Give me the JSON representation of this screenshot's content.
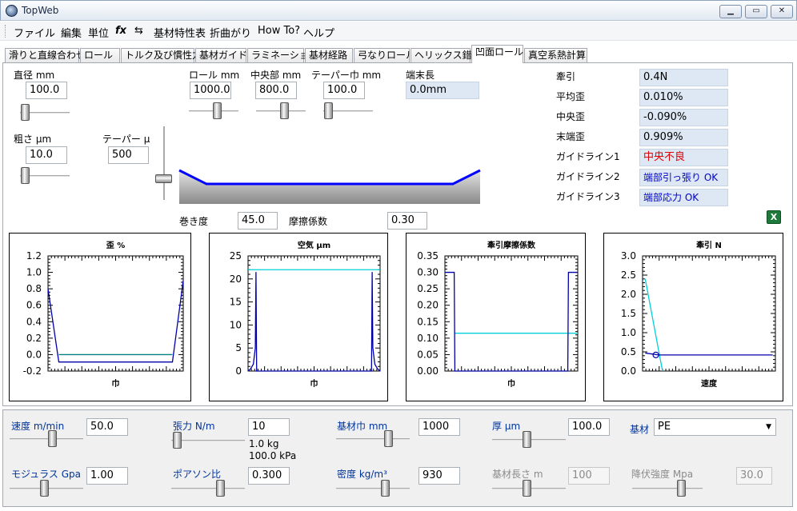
{
  "window": {
    "title": "TopWeb"
  },
  "menu": [
    "ファイル",
    "編集",
    "単位",
    "fx",
    "⇆",
    "基材特性表",
    "折曲がり",
    "How To?",
    "ヘルプ"
  ],
  "tabs": [
    "滑りと直線合わせ",
    "ロール",
    "トルク及び慣性力",
    "基材ガイド",
    "ラミネーション",
    "基材経路",
    "弓なりロール",
    "ヘリックス錯覚",
    "凹面ロール",
    "真空系熱計算"
  ],
  "active_tab": 8,
  "params": {
    "diameter": {
      "label": "直径 mm",
      "value": "100.0"
    },
    "roughness": {
      "label": "粗さ μm",
      "value": "10.0"
    },
    "taper": {
      "label": "テーパー μm",
      "value": "500"
    },
    "roll": {
      "label": "ロール mm",
      "value": "1000.0"
    },
    "center": {
      "label": "中央部 mm",
      "value": "800.0"
    },
    "taper_width": {
      "label": "テーパー巾 mm",
      "value": "100.0"
    },
    "end_length": {
      "label": "端末長",
      "value": "0.0mm"
    },
    "wrap": {
      "label": "巻き度",
      "value": "45.0"
    },
    "friction": {
      "label": "摩擦係数",
      "value": "0.30"
    }
  },
  "results": [
    {
      "label": "牽引",
      "value": "0.4N",
      "status": "normal"
    },
    {
      "label": "平均歪",
      "value": "0.010%",
      "status": "normal"
    },
    {
      "label": "中央歪",
      "value": "-0.090%",
      "status": "normal"
    },
    {
      "label": "末端歪",
      "value": "0.909%",
      "status": "normal"
    },
    {
      "label": "ガイドライン1",
      "value": "中央不良",
      "status": "bad"
    },
    {
      "label": "ガイドライン2",
      "value": "端部引っ張り OK",
      "status": "ok"
    },
    {
      "label": "ガイドライン3",
      "value": "端部応力 OK",
      "status": "ok"
    }
  ],
  "colors": {
    "navy": "#0000aa",
    "cyan": "#00d0d8",
    "green": "#008000",
    "profile": "#0000ff"
  },
  "chart_data": [
    {
      "type": "line",
      "title": "歪 %",
      "xlabel": "巾",
      "ylim": [
        -0.2,
        1.2
      ],
      "yticks": [
        -0.2,
        0.0,
        0.2,
        0.4,
        0.6,
        0.8,
        1.0,
        1.2
      ],
      "series": [
        {
          "color": "#0000aa",
          "x": [
            0,
            0.08,
            0.92,
            1
          ],
          "y": [
            0.8,
            -0.09,
            -0.09,
            0.9
          ]
        },
        {
          "color": "#008080",
          "x": [
            0.08,
            0.92
          ],
          "y": [
            0.0,
            0.0
          ]
        }
      ]
    },
    {
      "type": "line",
      "title": "空気 μm",
      "xlabel": "巾",
      "ylim": [
        0,
        25
      ],
      "yticks": [
        0,
        5,
        10,
        15,
        20,
        25
      ],
      "series": [
        {
          "color": "#00d0d8",
          "x": [
            0,
            1
          ],
          "y": [
            22,
            22
          ]
        },
        {
          "color": "#0000aa",
          "x": [
            0,
            0.02,
            0.04,
            0.055,
            0.06,
            0.065,
            0.935,
            0.94,
            0.945,
            0.96,
            0.98,
            1
          ],
          "y": [
            0,
            0.5,
            1.5,
            5,
            21.5,
            0,
            0,
            21.5,
            5,
            1.5,
            0.5,
            0
          ]
        }
      ]
    },
    {
      "type": "line",
      "title": "牽引摩擦係数",
      "xlabel": "巾",
      "ylim": [
        0,
        0.35
      ],
      "yticks": [
        0.0,
        0.05,
        0.1,
        0.15,
        0.2,
        0.25,
        0.3,
        0.35
      ],
      "series": [
        {
          "color": "#00d0d8",
          "x": [
            0.07,
            1
          ],
          "y": [
            0.115,
            0.115
          ]
        },
        {
          "color": "#0000aa",
          "x": [
            0,
            0.07,
            0.075,
            0.08,
            0.92,
            0.925,
            0.93,
            1
          ],
          "y": [
            0.3,
            0.3,
            0.0,
            0.0,
            0.0,
            0.0,
            0.3,
            0.3
          ]
        }
      ]
    },
    {
      "type": "line",
      "title": "牽引 N",
      "xlabel": "速度",
      "ylim": [
        0,
        3.0
      ],
      "yticks": [
        0.0,
        0.5,
        1.0,
        1.5,
        2.0,
        2.5,
        3.0
      ],
      "series": [
        {
          "color": "#00d0d8",
          "x": [
            0.02,
            0.15
          ],
          "y": [
            2.4,
            0
          ]
        },
        {
          "color": "#0000aa",
          "x": [
            0.02,
            0.12,
            0.5,
            0.98
          ],
          "y": [
            0.47,
            0.42,
            0.42,
            0.42
          ]
        }
      ],
      "marker": {
        "x": 0.1,
        "y": 0.42
      }
    }
  ],
  "bottom": {
    "speed": {
      "label": "速度 m/min",
      "value": "50.0"
    },
    "tension": {
      "label": "張力 N/m",
      "value": "10",
      "note1": "1.0 kg",
      "note2": "100.0 kPa"
    },
    "width": {
      "label": "基材巾 mm",
      "value": "1000"
    },
    "thickness": {
      "label": "厚 μm",
      "value": "100.0"
    },
    "material": {
      "label": "基材",
      "value": "PE"
    },
    "modulus": {
      "label": "モジュラス Gpa",
      "value": "1.00"
    },
    "poisson": {
      "label": "ポアソン比",
      "value": "0.300"
    },
    "density": {
      "label": "密度 kg/m³",
      "value": "930"
    },
    "length": {
      "label": "基材長さ m",
      "value": "100"
    },
    "yield": {
      "label": "降伏強度 Mpa",
      "value": "30.0"
    }
  }
}
